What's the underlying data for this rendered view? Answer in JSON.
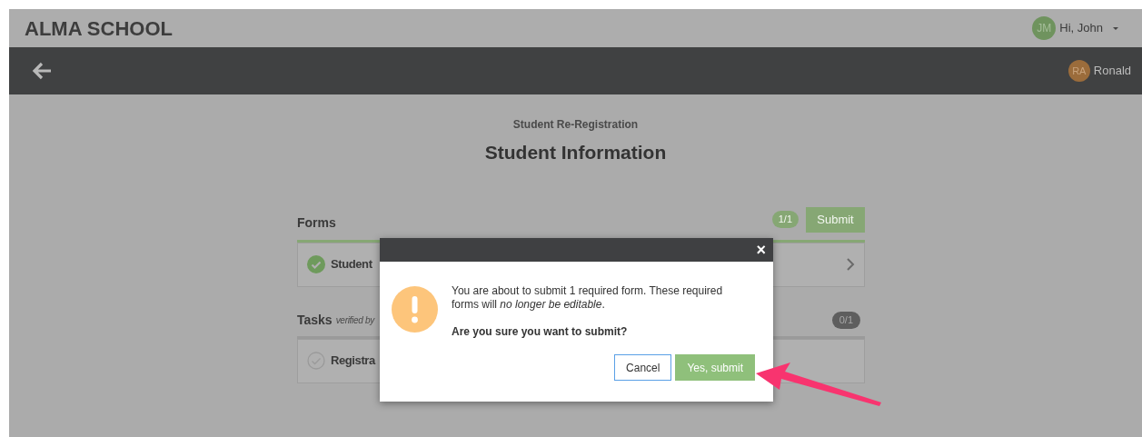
{
  "header": {
    "brand": "ALMA SCHOOL",
    "user": {
      "initials": "JM",
      "greeting": "Hi, John"
    }
  },
  "subbar": {
    "student": {
      "initials": "RA",
      "name": "Ronald"
    }
  },
  "page": {
    "subtitle": "Student Re-Registration",
    "title": "Student Information"
  },
  "forms": {
    "title": "Forms",
    "count": "1/1",
    "submit": "Submit",
    "items": [
      {
        "label": "Student",
        "done": true
      }
    ]
  },
  "tasks": {
    "title": "Tasks",
    "note": "verified by",
    "count": "0/1",
    "items": [
      {
        "label": "Registra",
        "done": false
      }
    ]
  },
  "dialog": {
    "close": "×",
    "message": "You are about to submit 1 required form. These required forms will *no longer be editable*.",
    "question": "Are you sure you want to submit?",
    "buttons": [
      {
        "label": "Cancel",
        "kind": "secondary"
      },
      {
        "label": "Yes, submit",
        "kind": "primary"
      }
    ]
  }
}
